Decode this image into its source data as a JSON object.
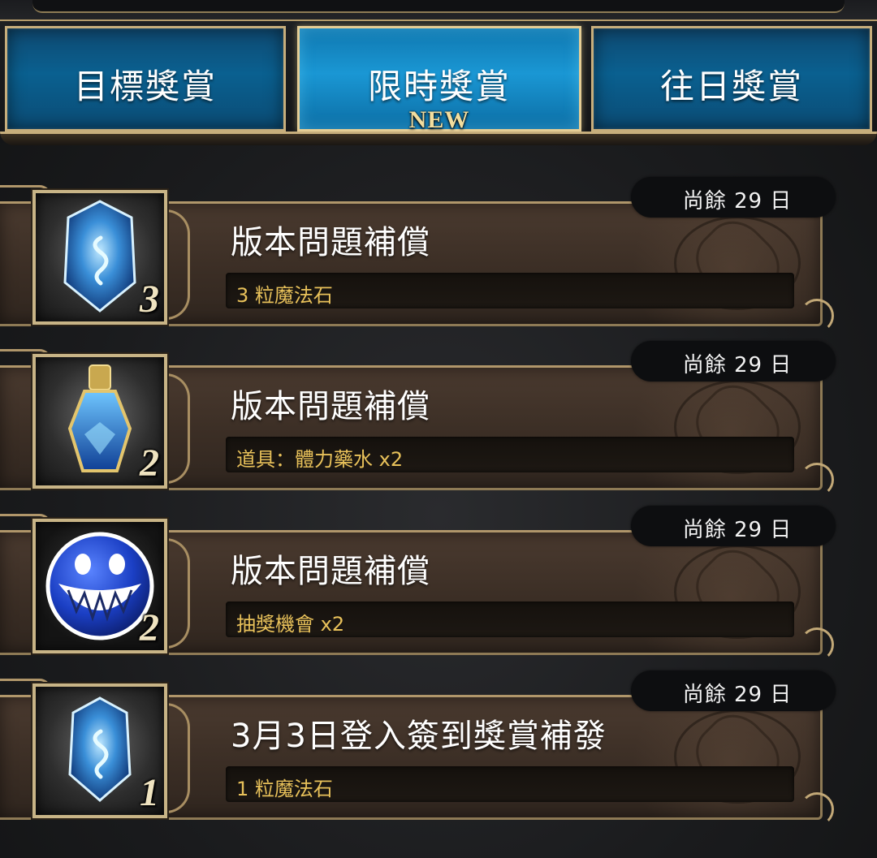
{
  "tabs": [
    {
      "label": "目標獎賞",
      "active": false
    },
    {
      "label": "限時獎賞",
      "active": true,
      "badge": "NEW"
    },
    {
      "label": "往日獎賞",
      "active": false
    }
  ],
  "rewards": [
    {
      "title": "版本問題補償",
      "description": "3 粒魔法石",
      "days_left": "尚餘 29 日",
      "quantity": "3",
      "icon": "magic-stone-icon"
    },
    {
      "title": "版本問題補償",
      "description": "道具：體力藥水 x2",
      "days_left": "尚餘 29 日",
      "quantity": "2",
      "icon": "stamina-potion-icon"
    },
    {
      "title": "版本問題補償",
      "description": "抽獎機會 x2",
      "days_left": "尚餘 29 日",
      "quantity": "2",
      "icon": "lottery-chance-icon"
    },
    {
      "title": "3月3日登入簽到獎賞補發",
      "description": "1 粒魔法石",
      "days_left": "尚餘 29 日",
      "quantity": "1",
      "icon": "magic-stone-icon"
    }
  ],
  "colors": {
    "tab_blue": "#0a6090",
    "tab_active": "#1a97d4",
    "gold_border": "#c7ae7c",
    "desc_text": "#e8c15a",
    "panel_brown": "#3b2e25"
  }
}
